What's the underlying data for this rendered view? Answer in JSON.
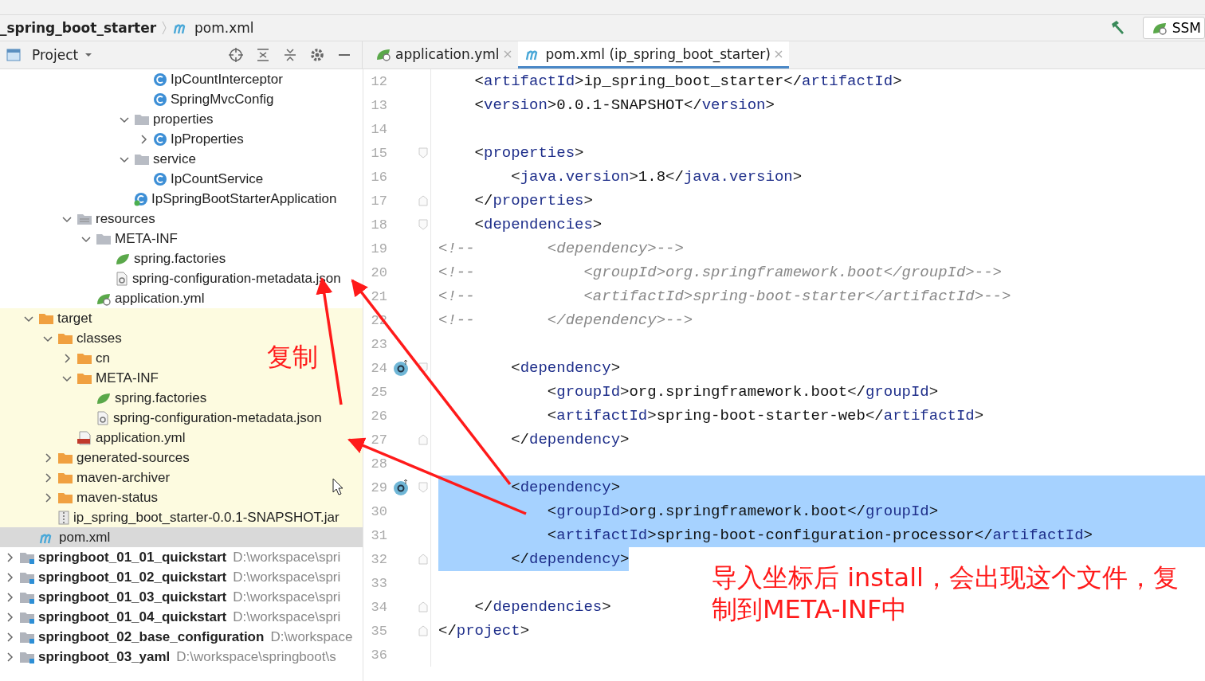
{
  "breadcrumb": {
    "project": "_spring_boot_starter",
    "file": "pom.xml"
  },
  "run_config": {
    "label": "SSM"
  },
  "project_panel": {
    "title": "Project"
  },
  "tree": [
    {
      "children": [
        {
          "children": [
            {
              "children": [
                {
                  "children": [
                    {
                      "children": [
                        {
                          "children": [
                            {
                              "children": [
                                {
                                  "label": "IpCountInterceptor",
                                  "kind": "class",
                                  "selected": false,
                                  "excluded": false
                                },
                                {
                                  "label": "SpringMvcConfig",
                                  "kind": "class",
                                  "selected": false,
                                  "excluded": false
                                }
                              ]
                            },
                            {
                              "label": "properties",
                              "kind": "package",
                              "expanded": true,
                              "selected": false,
                              "excluded": false,
                              "children": [
                                {
                                  "label": "IpProperties",
                                  "kind": "class",
                                  "expanded": false,
                                  "selected": false,
                                  "excluded": false
                                }
                              ]
                            },
                            {
                              "label": "service",
                              "kind": "package",
                              "expanded": true,
                              "selected": false,
                              "excluded": false,
                              "children": [
                                {
                                  "label": "IpCountService",
                                  "kind": "class",
                                  "selected": false,
                                  "excluded": false
                                }
                              ]
                            },
                            {
                              "label": "IpSpringBootStarterApplication",
                              "kind": "app-class",
                              "selected": false,
                              "excluded": false
                            }
                          ]
                        }
                      ]
                    }
                  ]
                },
                {
                  "label": "resources",
                  "kind": "resources",
                  "expanded": true,
                  "selected": false,
                  "excluded": false,
                  "children": [
                    {
                      "label": "META-INF",
                      "kind": "package",
                      "expanded": true,
                      "selected": false,
                      "excluded": false,
                      "children": [
                        {
                          "label": "spring.factories",
                          "kind": "spring-file",
                          "selected": false,
                          "excluded": false
                        },
                        {
                          "label": "spring-configuration-metadata.json",
                          "kind": "json-file",
                          "selected": false,
                          "excluded": false
                        }
                      ]
                    },
                    {
                      "label": "application.yml",
                      "kind": "spring-config",
                      "selected": false,
                      "excluded": false
                    }
                  ]
                }
              ]
            }
          ]
        },
        {
          "label": "target",
          "kind": "folder",
          "expanded": true,
          "selected": false,
          "excluded": true,
          "children": [
            {
              "label": "classes",
              "kind": "folder",
              "expanded": true,
              "selected": false,
              "excluded": true,
              "children": [
                {
                  "label": "cn",
                  "kind": "folder",
                  "expanded": false,
                  "selected": false,
                  "excluded": true
                },
                {
                  "label": "META-INF",
                  "kind": "folder",
                  "expanded": true,
                  "selected": false,
                  "excluded": true,
                  "children": [
                    {
                      "label": "spring.factories",
                      "kind": "spring-file",
                      "selected": false,
                      "excluded": true
                    },
                    {
                      "label": "spring-configuration-metadata.json",
                      "kind": "json-file",
                      "selected": false,
                      "excluded": true
                    }
                  ]
                },
                {
                  "label": "application.yml",
                  "kind": "yaml-file",
                  "selected": false,
                  "excluded": true
                }
              ]
            },
            {
              "label": "generated-sources",
              "kind": "folder",
              "expanded": false,
              "selected": false,
              "excluded": true
            },
            {
              "label": "maven-archiver",
              "kind": "folder",
              "expanded": false,
              "selected": false,
              "excluded": true
            },
            {
              "label": "maven-status",
              "kind": "folder",
              "expanded": false,
              "selected": false,
              "excluded": true
            },
            {
              "label": "ip_spring_boot_starter-0.0.1-SNAPSHOT.jar",
              "kind": "jar-file",
              "selected": false,
              "excluded": true
            }
          ]
        },
        {
          "label": "pom.xml",
          "kind": "maven-file",
          "selected": true,
          "excluded": false
        }
      ]
    },
    {
      "label": "springboot_01_01_quickstart",
      "path": "D:\\workspace\\spri",
      "kind": "module",
      "expanded": false,
      "selected": false,
      "excluded": false
    },
    {
      "label": "springboot_01_02_quickstart",
      "path": "D:\\workspace\\spri",
      "kind": "module",
      "expanded": false,
      "selected": false,
      "excluded": false
    },
    {
      "label": "springboot_01_03_quickstart",
      "path": "D:\\workspace\\spri",
      "kind": "module",
      "expanded": false,
      "selected": false,
      "excluded": false
    },
    {
      "label": "springboot_01_04_quickstart",
      "path": "D:\\workspace\\spri",
      "kind": "module",
      "expanded": false,
      "selected": false,
      "excluded": false
    },
    {
      "label": "springboot_02_base_configuration",
      "path": "D:\\workspace",
      "kind": "module",
      "expanded": false,
      "selected": false,
      "excluded": false
    },
    {
      "label": "springboot_03_yaml",
      "path": "D:\\workspace\\springboot\\s",
      "kind": "module",
      "expanded": false,
      "selected": false,
      "excluded": false
    }
  ],
  "tabs": [
    {
      "label": "application.yml",
      "kind": "spring-config",
      "selected": false
    },
    {
      "label": "pom.xml (ip_spring_boot_starter)",
      "kind": "maven-file",
      "selected": true
    }
  ],
  "code_lines": [
    {
      "num": "12",
      "kind": "code",
      "text": "    <artifactId>ip_spring_boot_starter</artifactId>",
      "selected": false
    },
    {
      "num": "13",
      "kind": "code",
      "text": "    <version>0.0.1-SNAPSHOT</version>",
      "selected": false
    },
    {
      "num": "14"
    },
    {
      "num": "15",
      "kind": "code",
      "text": "    <properties>",
      "selected": false,
      "fold_start": true
    },
    {
      "num": "16",
      "kind": "code",
      "text": "        <java.version>1.8</java.version>",
      "selected": false
    },
    {
      "num": "17",
      "kind": "code",
      "text": "    </properties>",
      "selected": false,
      "fold_end": true
    },
    {
      "num": "18",
      "kind": "code",
      "text": "    <dependencies>",
      "selected": false,
      "fold_start": true
    },
    {
      "num": "19",
      "kind": "comment",
      "text": "<!--        <dependency>-->",
      "selected": false
    },
    {
      "num": "20",
      "kind": "comment",
      "text": "<!--            <groupId>org.springframework.boot</groupId>-->",
      "selected": false
    },
    {
      "num": "21",
      "kind": "comment",
      "text": "<!--            <artifactId>spring-boot-starter</artifactId>-->",
      "selected": false
    },
    {
      "num": "22",
      "kind": "comment",
      "text": "<!--        </dependency>-->",
      "selected": false
    },
    {
      "num": "23"
    },
    {
      "num": "24",
      "kind": "code",
      "text": "        <dependency>",
      "selected": false,
      "fold_start": true,
      "marker": true
    },
    {
      "num": "25",
      "kind": "code",
      "text": "            <groupId>org.springframework.boot</groupId>",
      "selected": false
    },
    {
      "num": "26",
      "kind": "code",
      "text": "            <artifactId>spring-boot-starter-web</artifactId>",
      "selected": false
    },
    {
      "num": "27",
      "kind": "code",
      "text": "        </dependency>",
      "selected": false,
      "fold_end": true
    },
    {
      "num": "28"
    },
    {
      "num": "29",
      "kind": "code",
      "text": "        <dependency>",
      "selected": true,
      "partial": false,
      "fold_start": true,
      "marker": true
    },
    {
      "num": "30",
      "kind": "code",
      "text": "            <groupId>org.springframework.boot</groupId>",
      "selected": true,
      "partial": false
    },
    {
      "num": "31",
      "kind": "code",
      "text": "            <artifactId>spring-boot-configuration-processor</artifactId>",
      "selected": true,
      "partial": false
    },
    {
      "num": "32",
      "kind": "code",
      "text": "        </dependency>",
      "selected": true,
      "partial": true,
      "fold_end": true
    },
    {
      "num": "33"
    },
    {
      "num": "34",
      "kind": "code",
      "text": "    </dependencies>",
      "selected": false,
      "fold_end": true
    },
    {
      "num": "35",
      "kind": "code",
      "text": "</project>",
      "selected": false,
      "fold_end": true
    },
    {
      "num": "36"
    }
  ],
  "annotations": [
    {
      "text": "复制"
    },
    {
      "text": "导入坐标后 install，会出现这个文件，复制到META-INF中"
    }
  ]
}
